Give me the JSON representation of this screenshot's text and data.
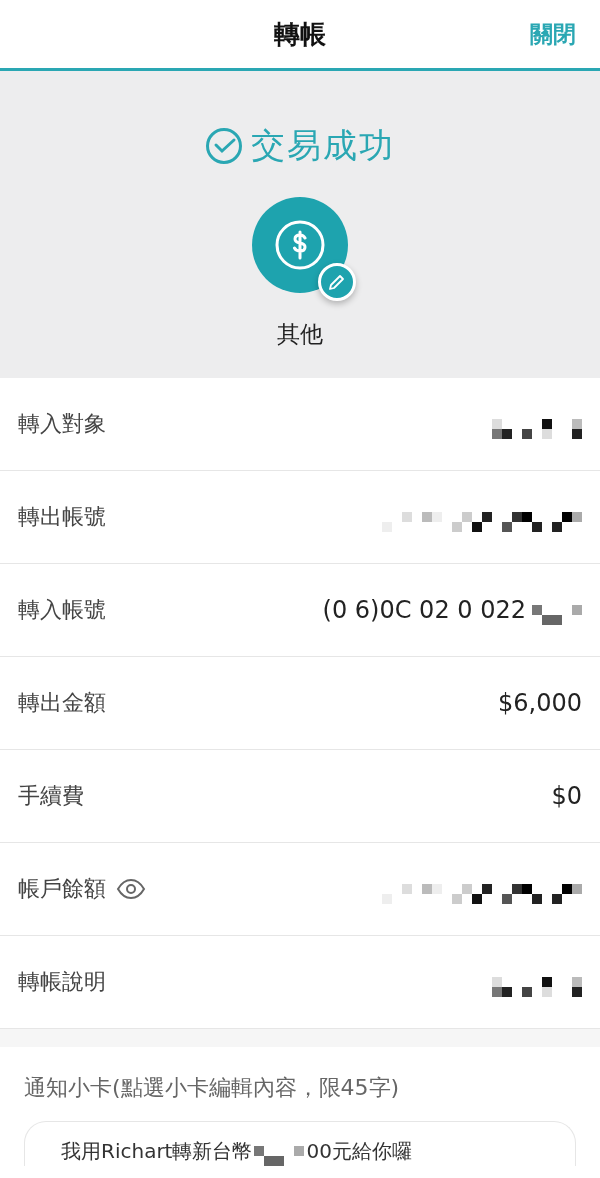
{
  "header": {
    "title": "轉帳",
    "close": "關閉"
  },
  "result": {
    "status": "交易成功",
    "category": "其他"
  },
  "rows": [
    {
      "label": "轉入對象",
      "kind": "masked",
      "reveal_icon": false
    },
    {
      "label": "轉出帳號",
      "kind": "masked",
      "reveal_icon": false
    },
    {
      "label": "轉入帳號",
      "kind": "partial",
      "value": "(0  6)0C 02 0 022",
      "reveal_icon": false
    },
    {
      "label": "轉出金額",
      "kind": "text",
      "value": "$6,000",
      "reveal_icon": false
    },
    {
      "label": "手續費",
      "kind": "text",
      "value": "$0",
      "reveal_icon": false
    },
    {
      "label": "帳戶餘額",
      "kind": "masked",
      "reveal_icon": true
    },
    {
      "label": "轉帳說明",
      "kind": "masked",
      "reveal_icon": false
    }
  ],
  "card_section": {
    "label": "通知小卡(點選小卡編輯內容，限45字)",
    "message_start": "我用Richart轉新台幣",
    "message_end": "00元給你囉"
  }
}
